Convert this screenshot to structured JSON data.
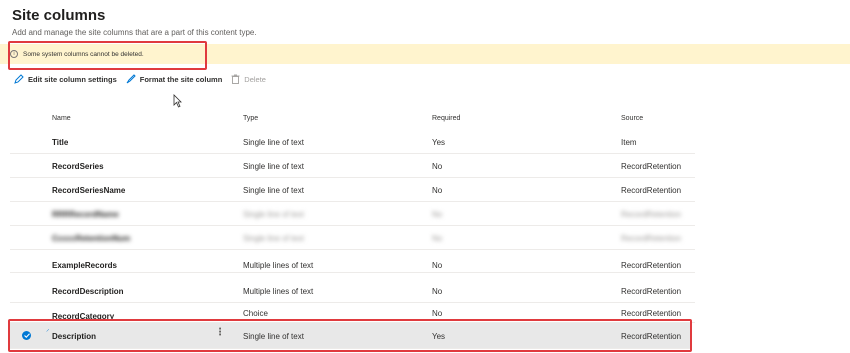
{
  "page": {
    "title": "Site columns",
    "subtitle": "Add and manage the site columns that are a part of this content type."
  },
  "warning": {
    "text": "Some system columns cannot be deleted."
  },
  "toolbar": {
    "edit_label": "Edit site column settings",
    "format_label": "Format the site column",
    "delete_label": "Delete"
  },
  "columns": {
    "name": "Name",
    "type": "Type",
    "required": "Required",
    "source": "Source"
  },
  "rows": [
    {
      "name": "Title",
      "type": "Single line of text",
      "required": "Yes",
      "source": "Item"
    },
    {
      "name": "RecordSeries",
      "type": "Single line of text",
      "required": "No",
      "source": "RecordRetention"
    },
    {
      "name": "RecordSeriesName",
      "type": "Single line of text",
      "required": "No",
      "source": "RecordRetention"
    },
    {
      "name": "ExampleRecords",
      "type": "Multiple lines of text",
      "required": "No",
      "source": "RecordRetention"
    },
    {
      "name": "RecordDescription",
      "type": "Multiple lines of text",
      "required": "No",
      "source": "RecordRetention"
    },
    {
      "name": "RecordCategory",
      "type": "Choice",
      "required": "No",
      "source": "RecordRetention"
    },
    {
      "name": "Description",
      "type": "Single line of text",
      "required": "Yes",
      "source": "RecordRetention"
    }
  ],
  "colors": {
    "accent": "#0078d4",
    "warning_bg": "#fff4ce",
    "highlight": "#e03a3e"
  }
}
